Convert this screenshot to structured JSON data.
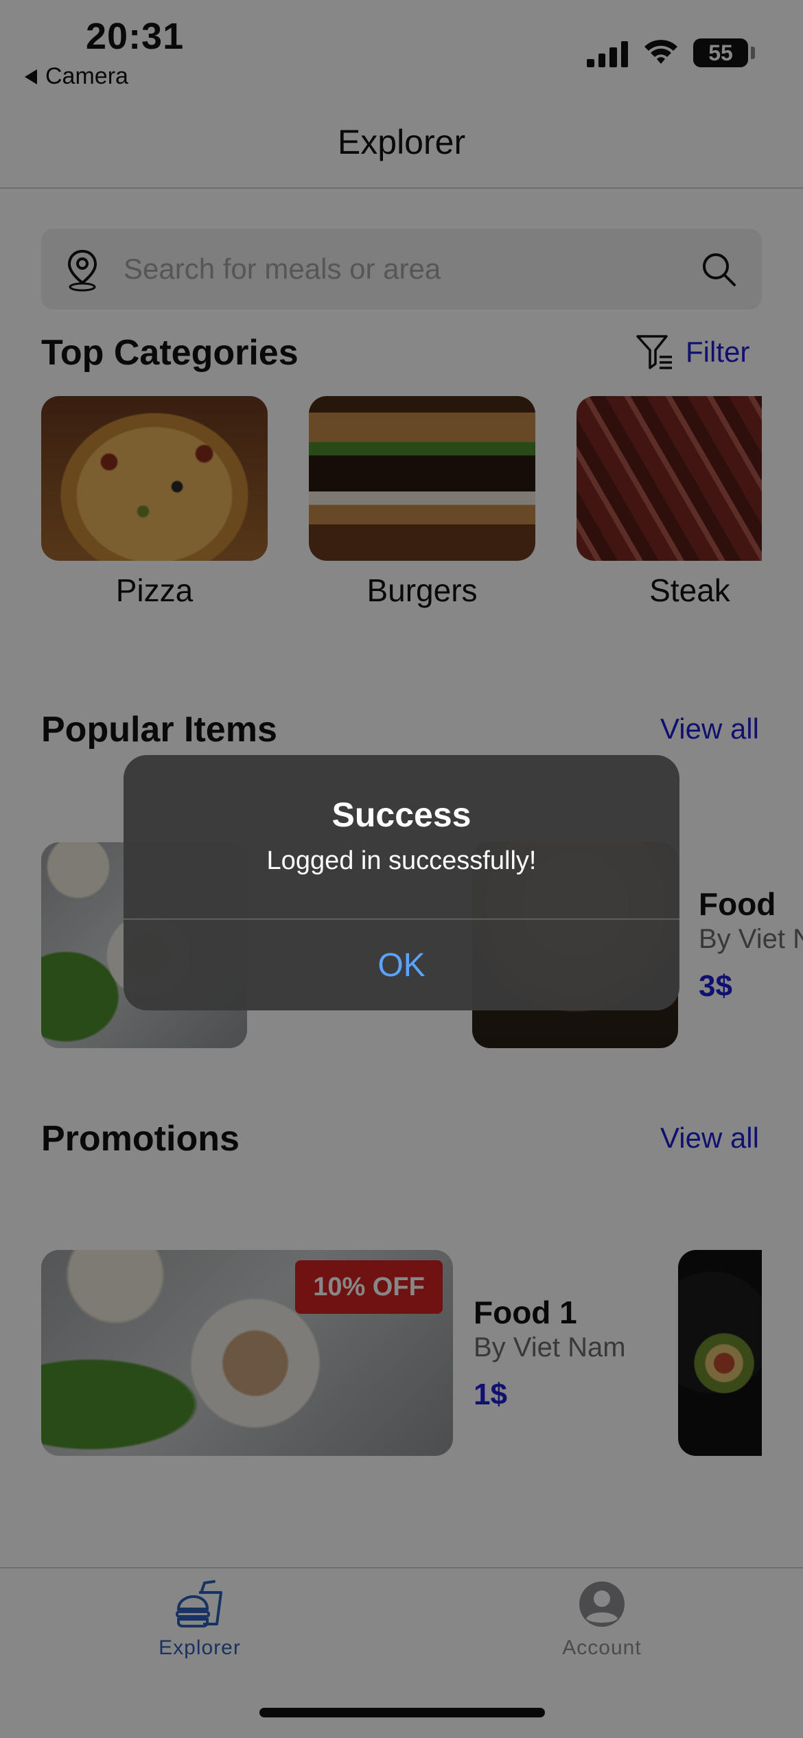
{
  "status_bar": {
    "time": "20:31",
    "back_label": "Camera",
    "battery": "55"
  },
  "nav": {
    "title": "Explorer"
  },
  "search": {
    "placeholder": "Search for meals or area",
    "value": ""
  },
  "categories": {
    "title": "Top Categories",
    "filter_label": "Filter",
    "items": [
      {
        "label": "Pizza"
      },
      {
        "label": "Burgers"
      },
      {
        "label": "Steak"
      }
    ]
  },
  "popular": {
    "title": "Popular Items",
    "view_all": "View all",
    "items": [
      {
        "title": "Food",
        "subtitle": "By Viet Nam",
        "price": "3$"
      }
    ]
  },
  "promotions": {
    "title": "Promotions",
    "view_all": "View all",
    "items": [
      {
        "badge": "10% OFF",
        "title": "Food 1",
        "subtitle": "By Viet Nam",
        "price": "1$"
      }
    ]
  },
  "tabs": [
    {
      "label": "Explorer",
      "icon": "fast-food-icon",
      "active": true
    },
    {
      "label": "Account",
      "icon": "person-circle-icon",
      "active": false
    }
  ],
  "alert": {
    "title": "Success",
    "message": "Logged in successfully!",
    "ok_label": "OK"
  },
  "colors": {
    "accent": "#1f1fd6",
    "tab_active": "#2f5fb8",
    "badge": "#d52222",
    "alert_button": "#5aa3ff"
  }
}
